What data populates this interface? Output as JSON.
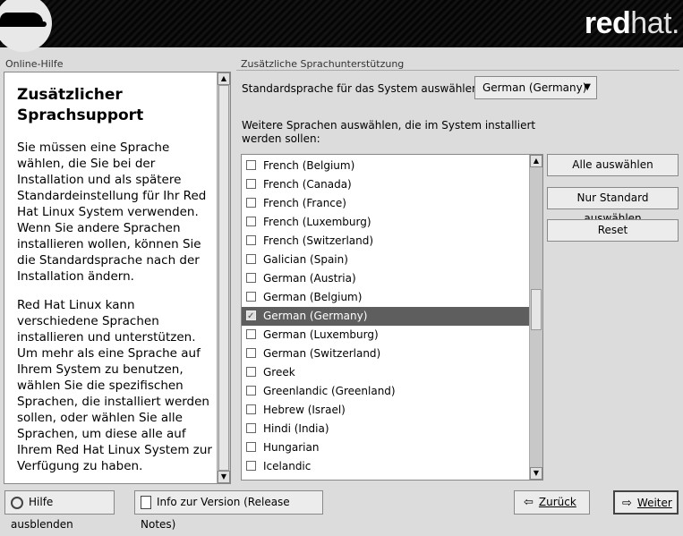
{
  "brand": {
    "wordmark_bold": "red",
    "wordmark_light": "hat."
  },
  "help": {
    "caption": "Online-Hilfe",
    "title": "Zusätzlicher Sprachsupport",
    "paragraphs": [
      "Sie müssen eine Sprache wählen, die Sie bei der Installation und als spätere Standardeinstellung für Ihr Red Hat Linux System verwenden. Wenn Sie andere Sprachen installieren wollen, können Sie die Standardsprache nach der Installation ändern.",
      "Red Hat Linux kann verschiedene Sprachen installieren und unterstützen. Um mehr als eine Sprache auf Ihrem System zu benutzen, wählen Sie die spezifischen Sprachen, die installiert werden sollen, oder wählen Sie alle Sprachen, um diese alle auf Ihrem Red Hat Linux System zur Verfügung zu haben."
    ]
  },
  "main": {
    "caption": "Zusätzliche Sprachunterstützung",
    "default_label": "Standardsprache für das System auswählen:",
    "default_value": "German (Germany)",
    "more_label": "Weitere Sprachen auswählen, die im System installiert werden sollen:",
    "languages": [
      {
        "label": "French (Belgium)",
        "checked": false,
        "selected": false
      },
      {
        "label": "French (Canada)",
        "checked": false,
        "selected": false
      },
      {
        "label": "French (France)",
        "checked": false,
        "selected": false
      },
      {
        "label": "French (Luxemburg)",
        "checked": false,
        "selected": false
      },
      {
        "label": "French (Switzerland)",
        "checked": false,
        "selected": false
      },
      {
        "label": "Galician (Spain)",
        "checked": false,
        "selected": false
      },
      {
        "label": "German (Austria)",
        "checked": false,
        "selected": false
      },
      {
        "label": "German (Belgium)",
        "checked": false,
        "selected": false
      },
      {
        "label": "German (Germany)",
        "checked": true,
        "selected": true
      },
      {
        "label": "German (Luxemburg)",
        "checked": false,
        "selected": false
      },
      {
        "label": "German (Switzerland)",
        "checked": false,
        "selected": false
      },
      {
        "label": "Greek",
        "checked": false,
        "selected": false
      },
      {
        "label": "Greenlandic (Greenland)",
        "checked": false,
        "selected": false
      },
      {
        "label": "Hebrew (Israel)",
        "checked": false,
        "selected": false
      },
      {
        "label": "Hindi (India)",
        "checked": false,
        "selected": false
      },
      {
        "label": "Hungarian",
        "checked": false,
        "selected": false
      },
      {
        "label": "Icelandic",
        "checked": false,
        "selected": false
      }
    ],
    "select_all": "Alle auswählen",
    "default_only": "Nur Standard auswählen",
    "reset": "Reset"
  },
  "footer": {
    "hide_help": "Hilfe ausblenden",
    "release_notes": "Info zur Version (Release Notes)",
    "back": "Zurück",
    "next": "Weiter"
  },
  "icons": {
    "help": "help-icon",
    "document": "document-icon",
    "back": "arrow-left-icon",
    "next": "arrow-right-icon",
    "logo": "redhat-shadowman-logo"
  }
}
